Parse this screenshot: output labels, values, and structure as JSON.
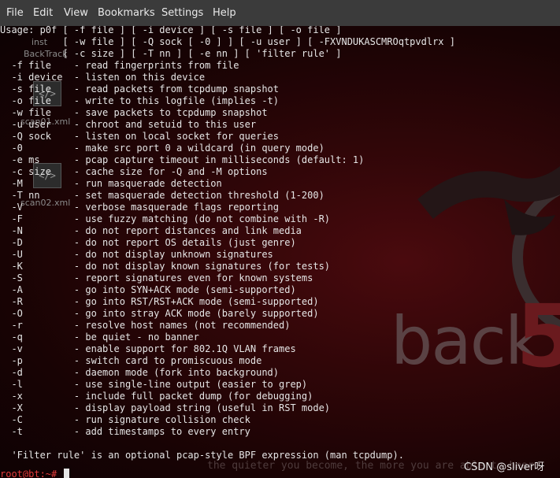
{
  "menubar": {
    "items": [
      "File",
      "Edit",
      "View",
      "Bookmarks",
      "Settings",
      "Help"
    ]
  },
  "terminal": {
    "lines": [
      "Usage: p0f [ -f file ] [ -i device ] [ -s file ] [ -o file ]",
      "           [ -w file ] [ -Q sock [ -0 ] ] [ -u user ] [ -FXVNDUKASCMROqtpvdlrx ]",
      "           [ -c size ] [ -T nn ] [ -e nn ] [ 'filter rule' ]",
      "  -f file    - read fingerprints from file",
      "  -i device  - listen on this device",
      "  -s file    - read packets from tcpdump snapshot",
      "  -o file    - write to this logfile (implies -t)",
      "  -w file    - save packets to tcpdump snapshot",
      "  -u user    - chroot and setuid to this user",
      "  -Q sock    - listen on local socket for queries",
      "  -0         - make src port 0 a wildcard (in query mode)",
      "  -e ms      - pcap capture timeout in milliseconds (default: 1)",
      "  -c size    - cache size for -Q and -M options",
      "  -M         - run masquerade detection",
      "  -T nn      - set masquerade detection threshold (1-200)",
      "  -V         - verbose masquerade flags reporting",
      "  -F         - use fuzzy matching (do not combine with -R)",
      "  -N         - do not report distances and link media",
      "  -D         - do not report OS details (just genre)",
      "  -U         - do not display unknown signatures",
      "  -K         - do not display known signatures (for tests)",
      "  -S         - report signatures even for known systems",
      "  -A         - go into SYN+ACK mode (semi-supported)",
      "  -R         - go into RST/RST+ACK mode (semi-supported)",
      "  -O         - go into stray ACK mode (barely supported)",
      "  -r         - resolve host names (not recommended)",
      "  -q         - be quiet - no banner",
      "  -v         - enable support for 802.1Q VLAN frames",
      "  -p         - switch card to promiscuous mode",
      "  -d         - daemon mode (fork into background)",
      "  -l         - use single-line output (easier to grep)",
      "  -x         - include full packet dump (for debugging)",
      "  -X         - display payload string (useful in RST mode)",
      "  -C         - run signature collision check",
      "  -t         - add timestamps to every entry",
      "",
      "  'Filter rule' is an optional pcap-style BPF expression (man tcpdump)."
    ],
    "prompt": "root@bt:~# "
  },
  "desktop": {
    "icon_labels": [
      "inst",
      "BackTrack",
      "scan01.xml",
      "scan02.xml"
    ],
    "logo_text": "back | track",
    "logo_number": "5",
    "quote": "the quieter you become, the more you are able to hear"
  },
  "watermark": "CSDN @sliver呀",
  "colors": {
    "menubar_bg": "#3b3b3b",
    "terminal_fg": "#e6e6e6",
    "prompt": "#e23b3b",
    "background": "#300608"
  }
}
